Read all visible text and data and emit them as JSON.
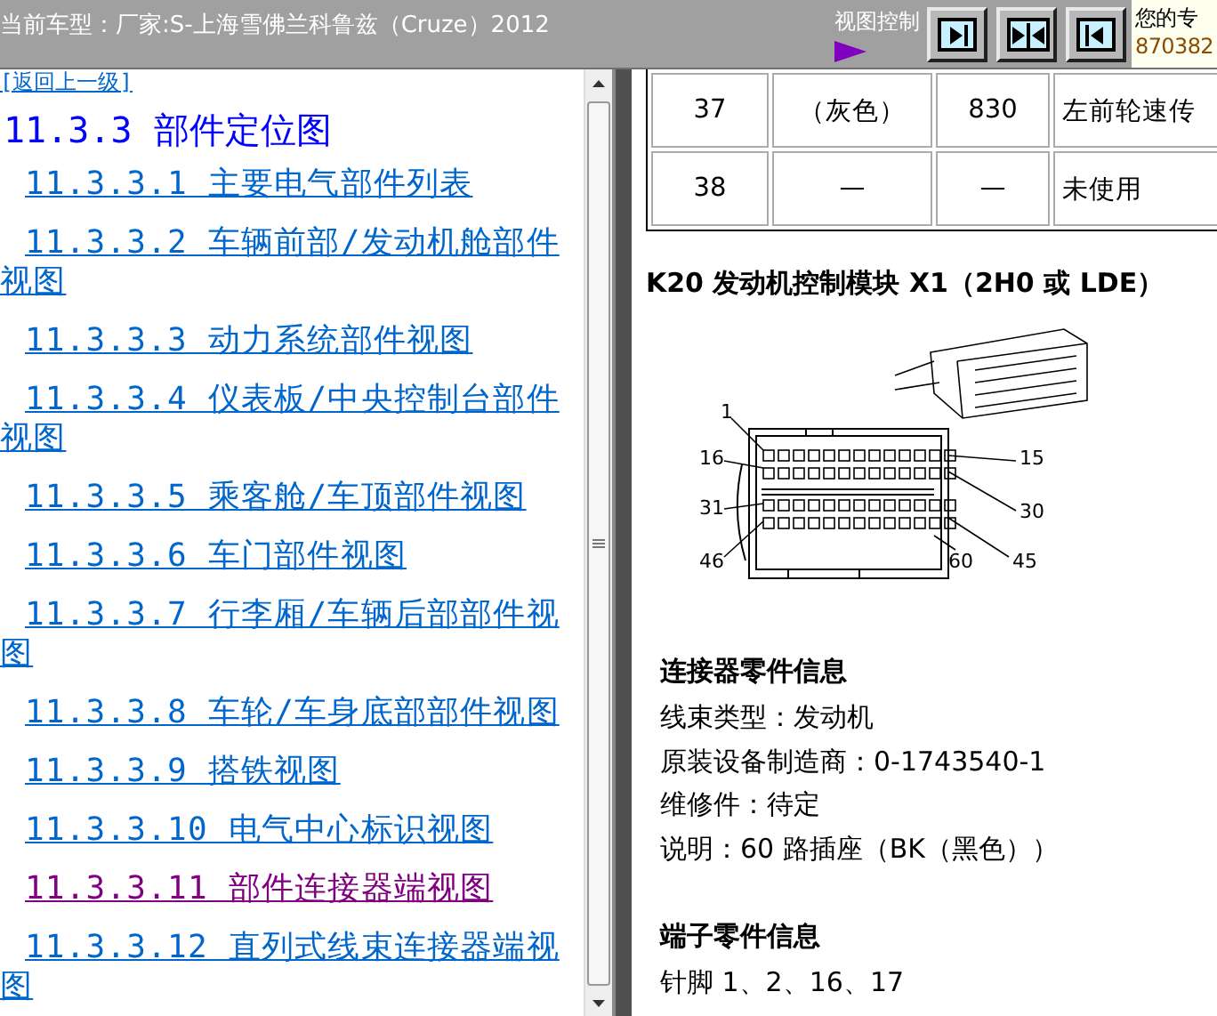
{
  "header": {
    "title": "当前车型：厂家:S-上海雪佛兰科鲁兹（Cruze）2012",
    "view_control": {
      "label": "视图控制",
      "buttons": [
        {
          "kind": "right"
        },
        {
          "kind": "center"
        },
        {
          "kind": "left"
        }
      ]
    },
    "user_panel": {
      "line_1": "您的专",
      "line_2": "870382"
    }
  },
  "nav": {
    "back_link": "[返回上一级]",
    "heading": "11.3.3 部件定位图",
    "links": [
      {
        "label": "11.3.3.1 主要电气部件列表",
        "visited": false
      },
      {
        "label": "11.3.3.2 车辆前部/发动机舱部件视图",
        "visited": false
      },
      {
        "label": "11.3.3.3 动力系统部件视图",
        "visited": false
      },
      {
        "label": "11.3.3.4 仪表板/中央控制台部件视图",
        "visited": false
      },
      {
        "label": "11.3.3.5 乘客舱/车顶部件视图",
        "visited": false
      },
      {
        "label": "11.3.3.6 车门部件视图",
        "visited": false
      },
      {
        "label": "11.3.3.7 行李厢/车辆后部部件视图",
        "visited": false
      },
      {
        "label": "11.3.3.8 车轮/车身底部部件视图",
        "visited": false
      },
      {
        "label": "11.3.3.9 搭铁视图",
        "visited": false
      },
      {
        "label": "11.3.3.10 电气中心标识视图",
        "visited": false
      },
      {
        "label": "11.3.3.11 部件连接器端视图",
        "visited": true
      },
      {
        "label": "11.3.3.12 直列式线束连接器端视图",
        "visited": false
      }
    ]
  },
  "content": {
    "table": {
      "rows": [
        [
          "37",
          "（灰色）",
          "830",
          "左前轮速传"
        ],
        [
          "38",
          "—",
          "—",
          "未使用"
        ]
      ]
    },
    "heading": "K20 发动机控制模块 X1（2H0 或 LDE）",
    "diagram": {
      "pin_labels": [
        "1",
        "16",
        "15",
        "31",
        "30",
        "46",
        "60",
        "45"
      ]
    },
    "connector_info": {
      "title": "连接器零件信息",
      "lines": [
        "线束类型：发动机",
        "原装设备制造商：0-1743540-1",
        "维修件：待定",
        "说明：60 路插座（BK（黑色））"
      ]
    },
    "terminal_info": {
      "title": "端子零件信息",
      "lines": [
        "针脚 1、2、16、17"
      ]
    }
  }
}
